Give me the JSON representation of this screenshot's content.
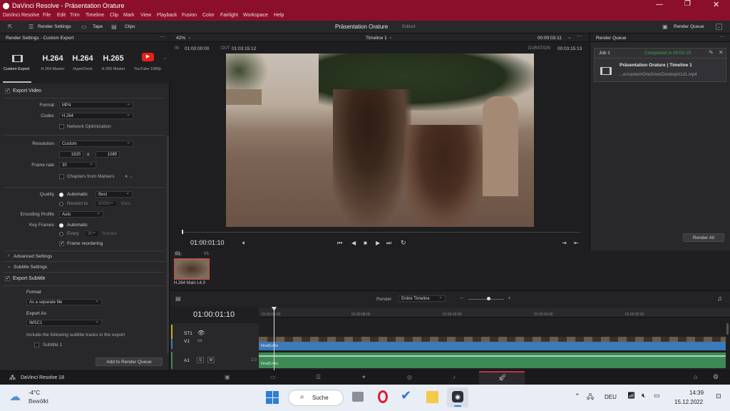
{
  "window": {
    "title": "DaVinci Resolve - Präsentation Orature"
  },
  "menu": [
    "DaVinci Resolve",
    "File",
    "Edit",
    "Trim",
    "Timeline",
    "Clip",
    "Mark",
    "View",
    "Playback",
    "Fusion",
    "Color",
    "Fairlight",
    "Workspace",
    "Help"
  ],
  "toolbar": {
    "render_settings": "Render Settings",
    "tape": "Tape",
    "clips": "Clips",
    "project": "Präsentation Orature",
    "edited": "Edited",
    "render_queue": "Render Queue"
  },
  "left": {
    "header": "Render Settings - Custom Export",
    "presets": [
      {
        "big": "",
        "label": "Custom Export"
      },
      {
        "big": "H.264",
        "label": "H.264 Master"
      },
      {
        "big": "H.264",
        "label": "HyperDeck"
      },
      {
        "big": "H.265",
        "label": "H.265 Master"
      },
      {
        "big": "",
        "label": "YouTube 1080p"
      }
    ],
    "export_video": "Export Video",
    "format_label": "Format",
    "format": "MP4",
    "codec_label": "Codec",
    "codec": "H.264",
    "network_opt": "Network Optimization",
    "resolution_label": "Resolution",
    "resolution": "Custom",
    "width": "1920",
    "x": "x",
    "height": "1080",
    "framerate_label": "Frame rate",
    "framerate": "30",
    "chapters": "Chapters from Markers",
    "quality_label": "Quality",
    "quality_auto": "Automatic",
    "quality_best": "Best",
    "restrict": "Restrict to",
    "restrict_val": "80000",
    "kbs": "Kb/s",
    "encoding_label": "Encoding Profile",
    "encoding": "Auto",
    "keyframes_label": "Key Frames",
    "kf_auto": "Automatic",
    "kf_every": "Every",
    "kf_val": "30",
    "kf_frames": "frames",
    "frame_reordering": "Frame reordering",
    "advanced": "Advanced Settings",
    "subtitle_settings": "Subtitle Settings",
    "export_subtitle": "Export Subtitle",
    "sub_format_label": "Format",
    "sub_format": "As a separate file",
    "export_as_label": "Export As",
    "export_as": "IMSC1",
    "include_text": "Include the following subtitle tracks in the export",
    "subtitle1": "Subtitle 1",
    "add_to_queue": "Add to Render Queue"
  },
  "viewer": {
    "zoom": "42%",
    "timeline": "Timeline 1",
    "tc_top": "00:00:03:11",
    "in_label": "IN",
    "in": "01:00:00:00",
    "out_label": "OUT",
    "out": "01:03:15:12",
    "duration_label": "DURATION",
    "duration": "00:03:15:13",
    "timecode": "01:00:01:10"
  },
  "clip": {
    "num": "01",
    "track": "V1",
    "name": "H.264 Main L4.0"
  },
  "timeline": {
    "render_label": "Render",
    "render_mode": "Entire Timeline",
    "timecode": "01:00:01:10",
    "ruler": [
      "01:00:00:00",
      "01:00:08:00",
      "01:00:16:00",
      "01:00:24:00",
      "01:00:32:00"
    ],
    "st1": "ST1",
    "v1": "V1",
    "a1": "A1",
    "s": "S",
    "m": "M",
    "a1_val": "2.0",
    "video_clip": "Final3.mkv",
    "audio_clip": "Final3.mkv"
  },
  "render_queue": {
    "header": "Render Queue",
    "job": "Job 1",
    "status": "Completed in 00:03:15",
    "title": "Präsentation Orature | Timeline 1",
    "path": "...ers\\artem\\OneDrive\\Desktop\\Cut1.mp4",
    "render_all": "Render All"
  },
  "pagebar": {
    "app": "DaVinci Resolve 18"
  },
  "taskbar": {
    "temp": "-4°C",
    "weather": "Bewölkt",
    "search": "Suche",
    "lang": "DEU",
    "time": "14:39",
    "date": "15.12.2022"
  },
  "colors": {
    "titlebar": "#8c0f29",
    "accent_green": "#3fa34d",
    "clip_blue": "#3b7bb8",
    "audio_green": "#3d8a55"
  }
}
